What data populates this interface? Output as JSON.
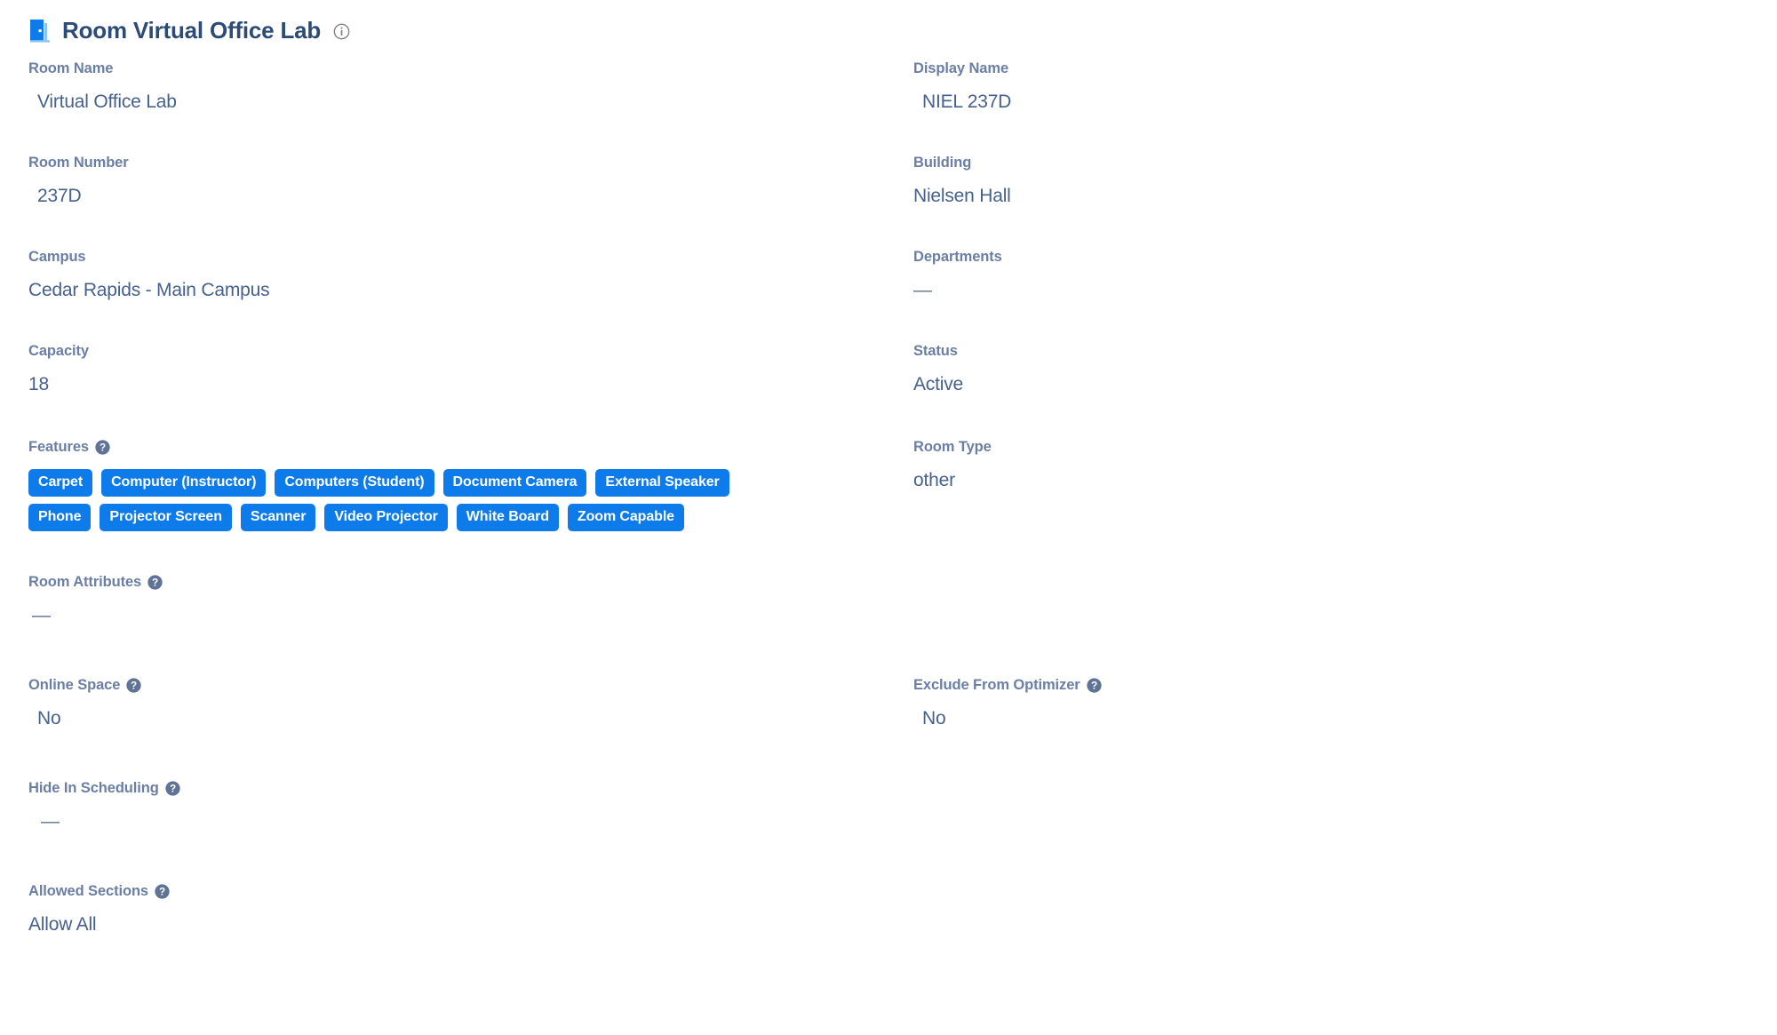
{
  "header": {
    "title": "Room Virtual Office Lab",
    "door_icon": "door-icon",
    "info_icon": "info-circle-icon"
  },
  "colors": {
    "label": "#6b7fa5",
    "value": "#46618c",
    "title": "#2c4b75",
    "tag_background": "#0d7bea",
    "tag_text": "#ffffff",
    "help_icon": "#5f7396"
  },
  "fields": {
    "room_name": {
      "label": "Room Name",
      "value": "Virtual Office Lab"
    },
    "display_name": {
      "label": "Display Name",
      "value": "NIEL 237D"
    },
    "room_number": {
      "label": "Room Number",
      "value": "237D"
    },
    "building": {
      "label": "Building",
      "value": "Nielsen Hall"
    },
    "campus": {
      "label": "Campus",
      "value": "Cedar Rapids - Main Campus"
    },
    "departments": {
      "label": "Departments",
      "value": "—"
    },
    "capacity": {
      "label": "Capacity",
      "value": "18"
    },
    "status": {
      "label": "Status",
      "value": "Active"
    },
    "features": {
      "label": "Features",
      "help": "?"
    },
    "room_type": {
      "label": "Room Type",
      "value": "other"
    },
    "room_attributes": {
      "label": "Room Attributes",
      "help": "?",
      "value": "—"
    },
    "online_space": {
      "label": "Online Space",
      "help": "?",
      "value": "No"
    },
    "exclude_from_optimizer": {
      "label": "Exclude From Optimizer",
      "help": "?",
      "value": "No"
    },
    "hide_in_scheduling": {
      "label": "Hide In Scheduling",
      "help": "?",
      "value": "—"
    },
    "allowed_sections": {
      "label": "Allowed Sections",
      "help": "?",
      "value": "Allow All"
    }
  },
  "feature_tags": [
    "Carpet",
    "Computer (Instructor)",
    "Computers (Student)",
    "Document Camera",
    "External Speaker",
    "Phone",
    "Projector Screen",
    "Scanner",
    "Video Projector",
    "White Board",
    "Zoom Capable"
  ]
}
